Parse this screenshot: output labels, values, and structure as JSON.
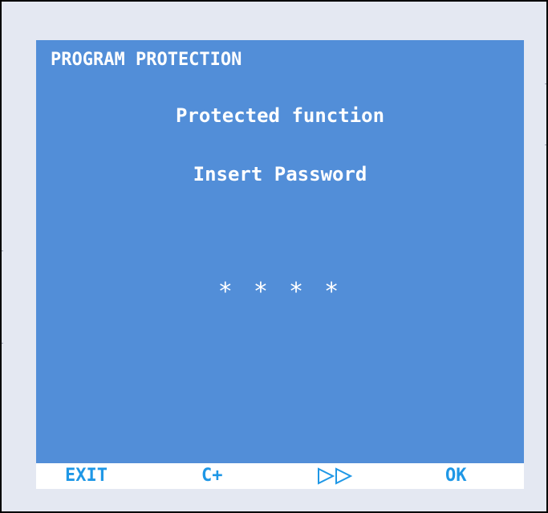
{
  "screen": {
    "title": "PROGRAM PROTECTION",
    "message_line_1": "Protected function",
    "message_line_2": "Insert Password",
    "password_mask": "* * * *"
  },
  "softkeys": {
    "exit_label": "EXIT",
    "cplus_label": "C+",
    "next_icon": "double-play-right-icon",
    "ok_label": "OK"
  },
  "colors": {
    "screen_background": "#528ed8",
    "softkey_text": "#1e97e6",
    "panel_background": "#e4e8f2"
  }
}
